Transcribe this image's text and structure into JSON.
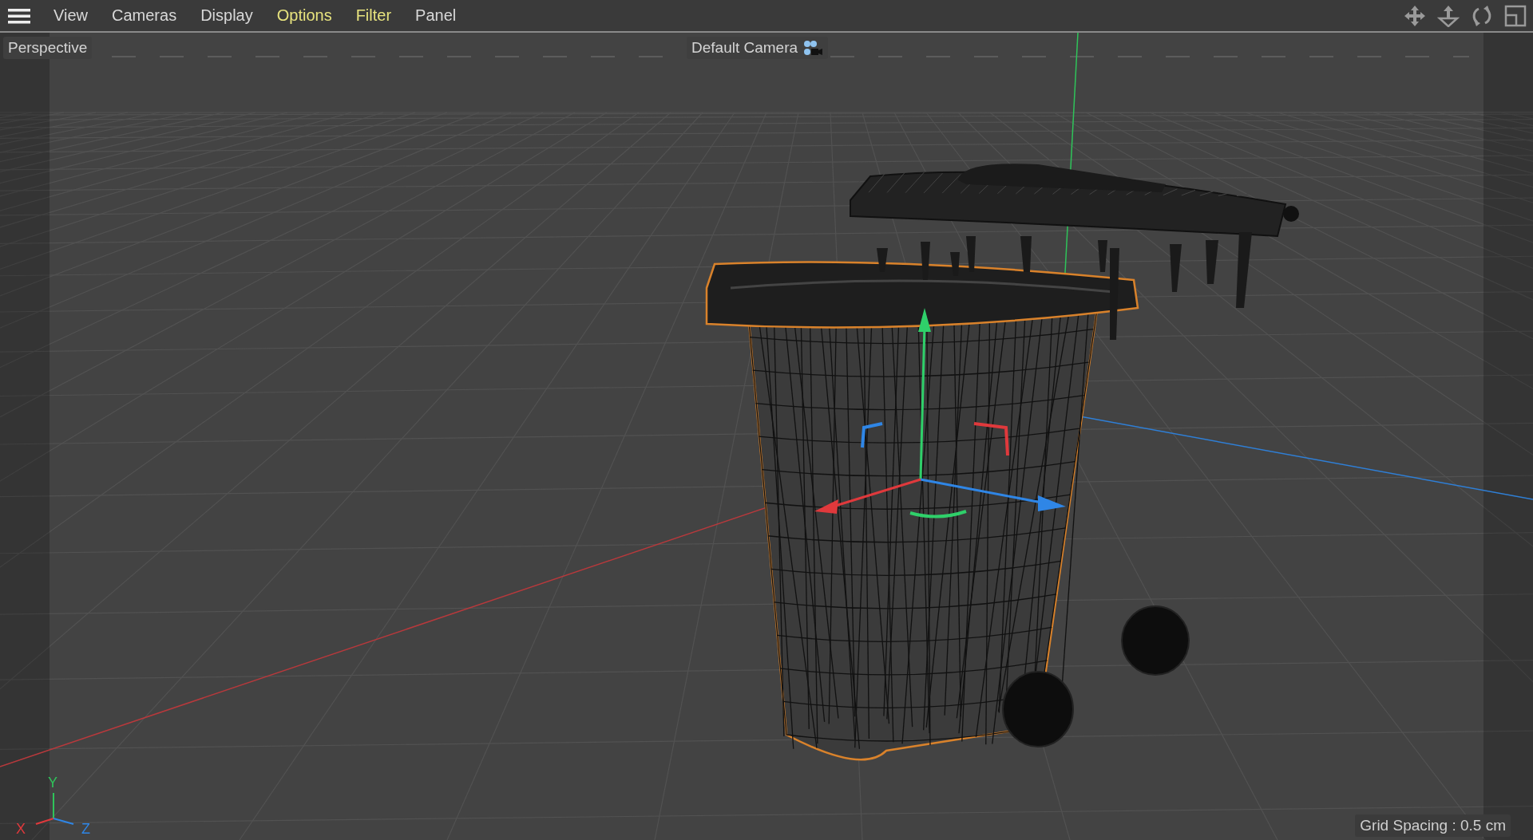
{
  "menu_bar": {
    "items": [
      {
        "label": "View",
        "highlighted": false
      },
      {
        "label": "Cameras",
        "highlighted": false
      },
      {
        "label": "Display",
        "highlighted": false
      },
      {
        "label": "Options",
        "highlighted": true
      },
      {
        "label": "Filter",
        "highlighted": true
      },
      {
        "label": "Panel",
        "highlighted": false
      }
    ]
  },
  "viewport": {
    "view_name": "Perspective",
    "camera": "Default Camera",
    "axis_labels": {
      "x": "X",
      "y": "Y",
      "z": "Z"
    },
    "grid_spacing": "Grid Spacing : 0.5 cm"
  }
}
